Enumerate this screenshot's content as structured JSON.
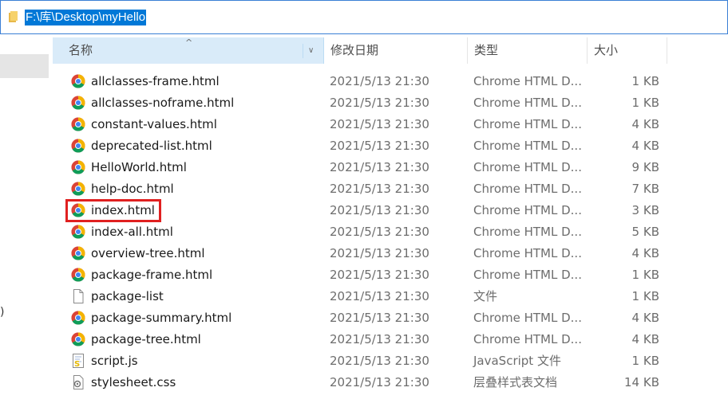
{
  "address_bar": {
    "path": "F:\\库\\Desktop\\myHello"
  },
  "nav": {
    "fragment": ")"
  },
  "columns": {
    "name": "名称",
    "date": "修改日期",
    "type": "类型",
    "size": "大小"
  },
  "files": [
    {
      "name": "allclasses-frame.html",
      "date": "2021/5/13 21:30",
      "type": "Chrome HTML D...",
      "size": "1 KB",
      "icon": "chrome-icon"
    },
    {
      "name": "allclasses-noframe.html",
      "date": "2021/5/13 21:30",
      "type": "Chrome HTML D...",
      "size": "1 KB",
      "icon": "chrome-icon"
    },
    {
      "name": "constant-values.html",
      "date": "2021/5/13 21:30",
      "type": "Chrome HTML D...",
      "size": "4 KB",
      "icon": "chrome-icon"
    },
    {
      "name": "deprecated-list.html",
      "date": "2021/5/13 21:30",
      "type": "Chrome HTML D...",
      "size": "4 KB",
      "icon": "chrome-icon"
    },
    {
      "name": "HelloWorld.html",
      "date": "2021/5/13 21:30",
      "type": "Chrome HTML D...",
      "size": "9 KB",
      "icon": "chrome-icon"
    },
    {
      "name": "help-doc.html",
      "date": "2021/5/13 21:30",
      "type": "Chrome HTML D...",
      "size": "7 KB",
      "icon": "chrome-icon"
    },
    {
      "name": "index.html",
      "date": "2021/5/13 21:30",
      "type": "Chrome HTML D...",
      "size": "3 KB",
      "icon": "chrome-icon",
      "highlighted": true
    },
    {
      "name": "index-all.html",
      "date": "2021/5/13 21:30",
      "type": "Chrome HTML D...",
      "size": "5 KB",
      "icon": "chrome-icon"
    },
    {
      "name": "overview-tree.html",
      "date": "2021/5/13 21:30",
      "type": "Chrome HTML D...",
      "size": "4 KB",
      "icon": "chrome-icon"
    },
    {
      "name": "package-frame.html",
      "date": "2021/5/13 21:30",
      "type": "Chrome HTML D...",
      "size": "1 KB",
      "icon": "chrome-icon"
    },
    {
      "name": "package-list",
      "date": "2021/5/13 21:30",
      "type": "文件",
      "size": "1 KB",
      "icon": "blank-file-icon"
    },
    {
      "name": "package-summary.html",
      "date": "2021/5/13 21:30",
      "type": "Chrome HTML D...",
      "size": "4 KB",
      "icon": "chrome-icon"
    },
    {
      "name": "package-tree.html",
      "date": "2021/5/13 21:30",
      "type": "Chrome HTML D...",
      "size": "4 KB",
      "icon": "chrome-icon"
    },
    {
      "name": "script.js",
      "date": "2021/5/13 21:30",
      "type": "JavaScript 文件",
      "size": "1 KB",
      "icon": "script-file-icon"
    },
    {
      "name": "stylesheet.css",
      "date": "2021/5/13 21:30",
      "type": "层叠样式表文档",
      "size": "14 KB",
      "icon": "css-file-icon"
    }
  ],
  "colors": {
    "selection_blue": "#0078d7",
    "header_hover": "#d9ebf9",
    "highlight_red": "#e02020",
    "nav_selected": "#e5e5e5"
  }
}
